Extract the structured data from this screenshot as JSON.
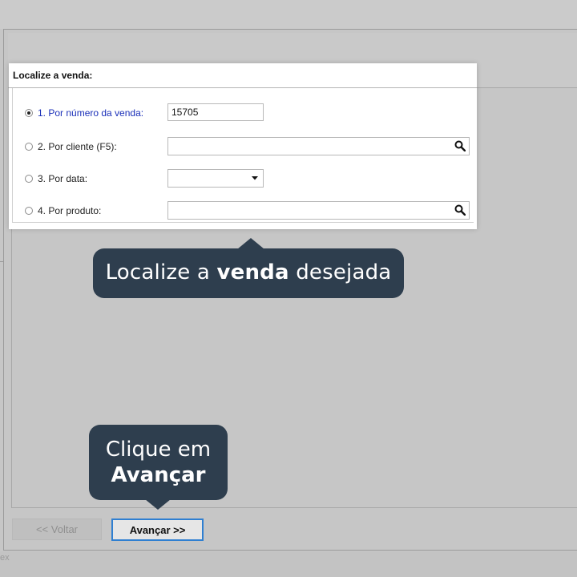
{
  "panel": {
    "title": "Localize a venda:",
    "options": [
      {
        "label": "1. Por número da venda:",
        "selected": true,
        "value": "15705"
      },
      {
        "label": "2. Por cliente (F5):",
        "selected": false,
        "value": ""
      },
      {
        "label": "3. Por data:",
        "selected": false,
        "value": ""
      },
      {
        "label": "4. Por produto:",
        "selected": false,
        "value": ""
      }
    ]
  },
  "callouts": {
    "find_sale": {
      "prefix": "Localize a ",
      "bold": "venda",
      "suffix": " desejada"
    },
    "click_next": {
      "line1": "Clique em",
      "line2": "Avançar"
    }
  },
  "wizard": {
    "back_label": "<< Voltar",
    "next_label": "Avançar >>"
  },
  "background": {
    "stray_text": "ex"
  },
  "colors": {
    "callout_bg": "#2e3e4e",
    "selected_option": "#1a2fb8",
    "focus_border": "#2f7fd1",
    "dim_overlay": "#c6c6c6"
  },
  "icons": [
    "radio-selected-icon",
    "radio-icon",
    "search-icon",
    "dropdown-arrow-icon"
  ]
}
